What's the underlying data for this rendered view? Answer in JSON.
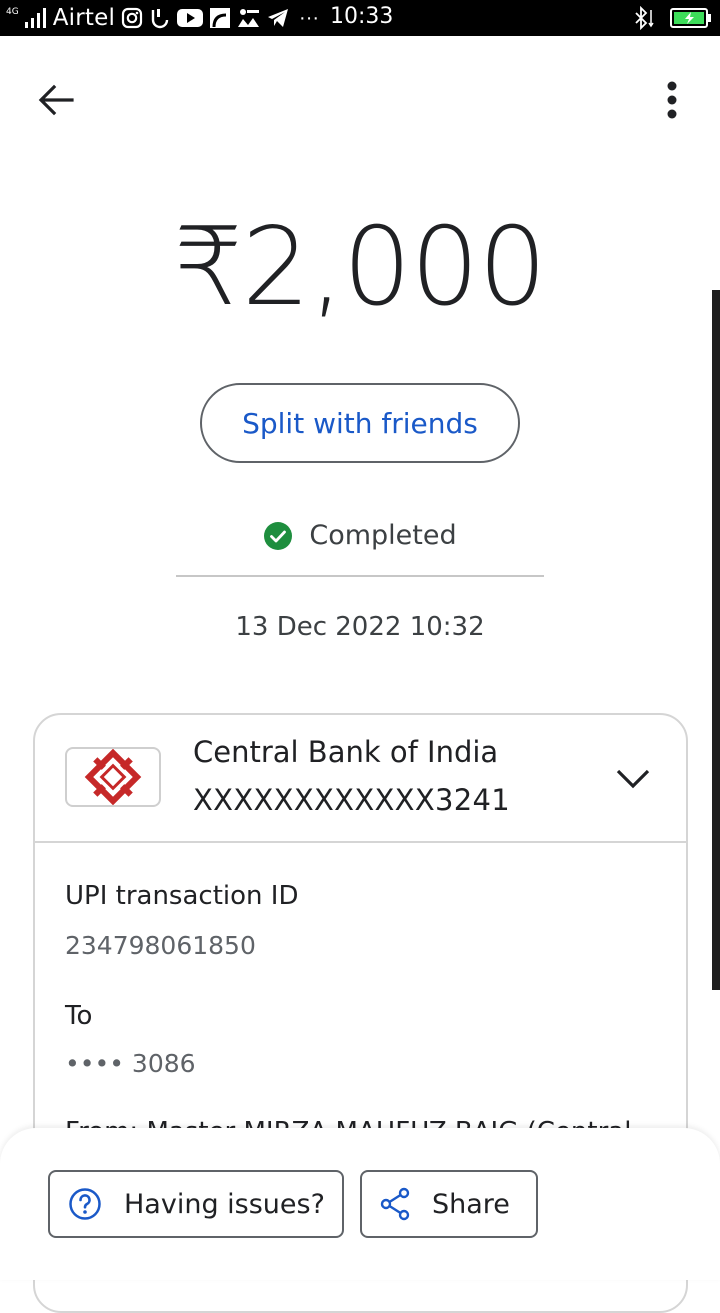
{
  "status_bar": {
    "network_type": "4G",
    "carrier": "Airtel",
    "time": "10:33",
    "more_dots": "···",
    "icons": [
      "signal-icon",
      "instagram-icon",
      "notification-icon",
      "youtube-icon",
      "app-icon",
      "ipl-icon",
      "telegram-icon",
      "bluetooth-icon",
      "battery-charging-icon"
    ]
  },
  "transaction": {
    "amount": "₹2,000",
    "split_label": "Split with friends",
    "status": "Completed",
    "datetime": "13 Dec 2022 10:32"
  },
  "account": {
    "bank_name": "Central Bank of India",
    "account_number": "XXXXXXXXXXXX3241"
  },
  "details": {
    "upi_label": "UPI transaction ID",
    "upi_value": "234798061850",
    "to_label": "To",
    "to_value": "•••• 3086",
    "from_line": "From: Master MIRZA MAHFUZ BAIG (Central"
  },
  "actions": {
    "issues_label": "Having issues?",
    "share_label": "Share"
  },
  "colors": {
    "accent": "#1a59c8",
    "success": "#1e8e3e",
    "bank_red": "#c62828"
  }
}
